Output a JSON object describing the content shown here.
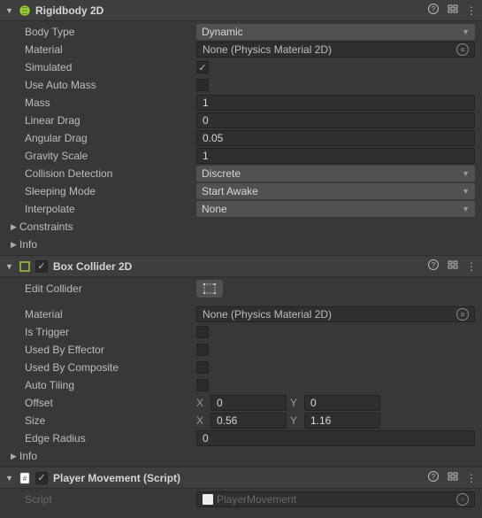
{
  "rigidbody": {
    "title": "Rigidbody 2D",
    "body_type_label": "Body Type",
    "body_type": "Dynamic",
    "material_label": "Material",
    "material": "None (Physics Material 2D)",
    "simulated_label": "Simulated",
    "use_auto_mass_label": "Use Auto Mass",
    "mass_label": "Mass",
    "mass": "1",
    "linear_drag_label": "Linear Drag",
    "linear_drag": "0",
    "angular_drag_label": "Angular Drag",
    "angular_drag": "0.05",
    "gravity_scale_label": "Gravity Scale",
    "gravity_scale": "1",
    "collision_detection_label": "Collision Detection",
    "collision_detection": "Discrete",
    "sleeping_mode_label": "Sleeping Mode",
    "sleeping_mode": "Start Awake",
    "interpolate_label": "Interpolate",
    "interpolate": "None",
    "constraints_label": "Constraints",
    "info_label": "Info"
  },
  "boxcollider": {
    "title": "Box Collider 2D",
    "edit_collider_label": "Edit Collider",
    "material_label": "Material",
    "material": "None (Physics Material 2D)",
    "is_trigger_label": "Is Trigger",
    "used_by_effector_label": "Used By Effector",
    "used_by_composite_label": "Used By Composite",
    "auto_tiling_label": "Auto Tiling",
    "offset_label": "Offset",
    "offset_x_label": "X",
    "offset_x": "0",
    "offset_y_label": "Y",
    "offset_y": "0",
    "size_label": "Size",
    "size_x_label": "X",
    "size_x": "0.56",
    "size_y_label": "Y",
    "size_y": "1.16",
    "edge_radius_label": "Edge Radius",
    "edge_radius": "0",
    "info_label": "Info"
  },
  "playermovement": {
    "title": "Player Movement (Script)",
    "script_label": "Script",
    "script_value": "PlayerMovement"
  }
}
